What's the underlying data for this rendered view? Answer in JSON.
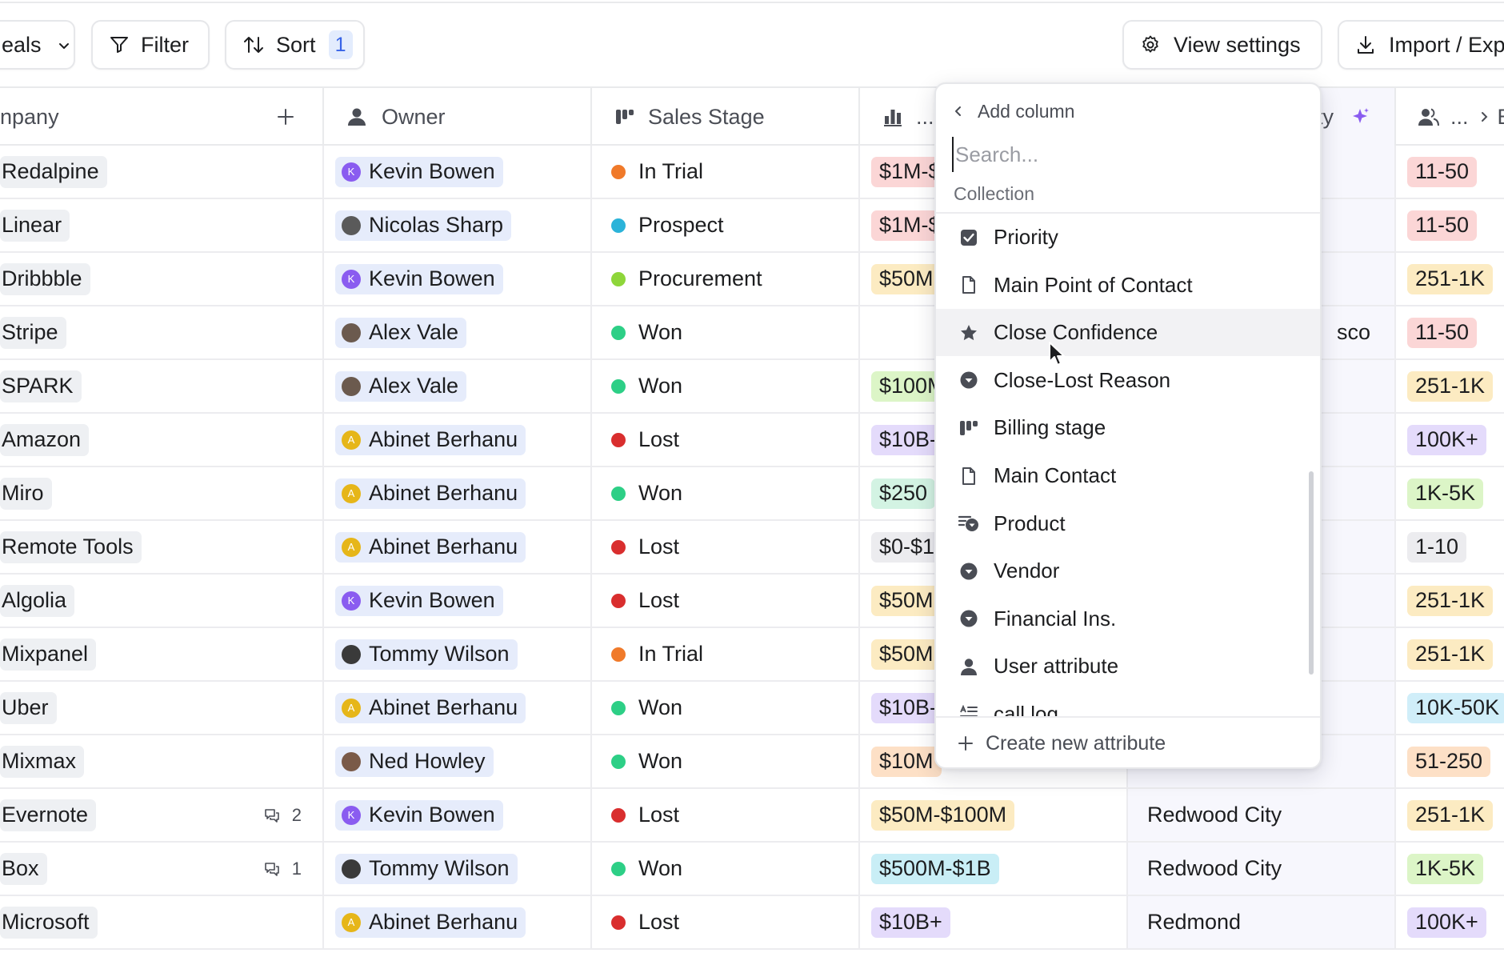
{
  "toolbar": {
    "view_selector_label": "eals",
    "filter_label": "Filter",
    "sort_label": "Sort",
    "sort_count": "1",
    "view_settings_label": "View settings",
    "import_export_label": "Import / Exp"
  },
  "columns": {
    "company": "npany",
    "owner": "Owner",
    "sales_stage": "Sales Stage",
    "col4": "...",
    "col5_suffix": "ty",
    "col6": "...",
    "col6_next": "E"
  },
  "rows": [
    {
      "company": "Redalpine",
      "owner": "Kevin Bowen",
      "owner_initial": "K",
      "avatar_color": "#8a5cf0",
      "stage": "In Trial",
      "stage_color": "#f07a2a",
      "revenue": "$1M-$",
      "revenue_color": "#fbd6d6",
      "location": "",
      "size": "11-50",
      "size_color": "#fbd6d6",
      "comments": ""
    },
    {
      "company": "Linear",
      "owner": "Nicolas Sharp",
      "owner_initial": "",
      "avatar_color": "#5a5a5a",
      "stage": "Prospect",
      "stage_color": "#2bb3d9",
      "revenue": "$1M-$",
      "revenue_color": "#fbd6d6",
      "location": "",
      "size": "11-50",
      "size_color": "#fbd6d6",
      "comments": ""
    },
    {
      "company": "Dribbble",
      "owner": "Kevin Bowen",
      "owner_initial": "K",
      "avatar_color": "#8a5cf0",
      "stage": "Procurement",
      "stage_color": "#8ed63a",
      "revenue": "$50M",
      "revenue_color": "#fcebc2",
      "location": "",
      "size": "251-1K",
      "size_color": "#fcebc2",
      "comments": ""
    },
    {
      "company": "Stripe",
      "owner": "Alex Vale",
      "owner_initial": "",
      "avatar_color": "#6b5a4e",
      "stage": "Won",
      "stage_color": "#2dcf86",
      "revenue": "",
      "revenue_color": "",
      "location": "sco",
      "size": "11-50",
      "size_color": "#fbd6d6",
      "comments": ""
    },
    {
      "company": "SPARK",
      "owner": "Alex Vale",
      "owner_initial": "",
      "avatar_color": "#6b5a4e",
      "stage": "Won",
      "stage_color": "#2dcf86",
      "revenue": "$100M",
      "revenue_color": "#dcf5c7",
      "location": "",
      "size": "251-1K",
      "size_color": "#fcebc2",
      "comments": ""
    },
    {
      "company": "Amazon",
      "owner": "Abinet Berhanu",
      "owner_initial": "A",
      "avatar_color": "#e6b619",
      "stage": "Lost",
      "stage_color": "#d92e2e",
      "revenue": "$10B-",
      "revenue_color": "#e4dbfb",
      "location": "",
      "size": "100K+",
      "size_color": "#e4dbfb",
      "comments": ""
    },
    {
      "company": "Miro",
      "owner": "Abinet Berhanu",
      "owner_initial": "A",
      "avatar_color": "#e6b619",
      "stage": "Won",
      "stage_color": "#2dcf86",
      "revenue": "$250",
      "revenue_color": "#d3f3e3",
      "location": "",
      "size": "1K-5K",
      "size_color": "#dcf5c7",
      "comments": ""
    },
    {
      "company": "Remote Tools",
      "owner": "Abinet Berhanu",
      "owner_initial": "A",
      "avatar_color": "#e6b619",
      "stage": "Lost",
      "stage_color": "#d92e2e",
      "revenue": "$0-$1",
      "revenue_color": "#ececef",
      "location": "",
      "size": "1-10",
      "size_color": "#ececef",
      "comments": ""
    },
    {
      "company": "Algolia",
      "owner": "Kevin Bowen",
      "owner_initial": "K",
      "avatar_color": "#8a5cf0",
      "stage": "Lost",
      "stage_color": "#d92e2e",
      "revenue": "$50M",
      "revenue_color": "#fcebc2",
      "location": "",
      "size": "251-1K",
      "size_color": "#fcebc2",
      "comments": ""
    },
    {
      "company": "Mixpanel",
      "owner": "Tommy Wilson",
      "owner_initial": "",
      "avatar_color": "#3a3a3a",
      "stage": "In Trial",
      "stage_color": "#f07a2a",
      "revenue": "$50M",
      "revenue_color": "#fcebc2",
      "location": "",
      "size": "251-1K",
      "size_color": "#fcebc2",
      "comments": ""
    },
    {
      "company": "Uber",
      "owner": "Abinet Berhanu",
      "owner_initial": "A",
      "avatar_color": "#e6b619",
      "stage": "Won",
      "stage_color": "#2dcf86",
      "revenue": "$10B-",
      "revenue_color": "#e4dbfb",
      "location": "",
      "size": "10K-50K",
      "size_color": "#d0eef9",
      "comments": ""
    },
    {
      "company": "Mixmax",
      "owner": "Ned Howley",
      "owner_initial": "",
      "avatar_color": "#7a5a48",
      "stage": "Won",
      "stage_color": "#2dcf86",
      "revenue": "$10M",
      "revenue_color": "#fde0c6",
      "location": "",
      "size": "51-250",
      "size_color": "#fde0c6",
      "comments": ""
    },
    {
      "company": "Evernote",
      "owner": "Kevin Bowen",
      "owner_initial": "K",
      "avatar_color": "#8a5cf0",
      "stage": "Lost",
      "stage_color": "#d92e2e",
      "revenue": "$50M-$100M",
      "revenue_color": "#fcebc2",
      "location": "Redwood City",
      "size": "251-1K",
      "size_color": "#fcebc2",
      "comments": "2"
    },
    {
      "company": "Box",
      "owner": "Tommy Wilson",
      "owner_initial": "",
      "avatar_color": "#3a3a3a",
      "stage": "Won",
      "stage_color": "#2dcf86",
      "revenue": "$500M-$1B",
      "revenue_color": "#c9eef6",
      "location": "Redwood City",
      "size": "1K-5K",
      "size_color": "#dcf5c7",
      "comments": "1"
    },
    {
      "company": "Microsoft",
      "owner": "Abinet Berhanu",
      "owner_initial": "A",
      "avatar_color": "#e6b619",
      "stage": "Lost",
      "stage_color": "#d92e2e",
      "revenue": "$10B+",
      "revenue_color": "#e4dbfb",
      "location": "Redmond",
      "size": "100K+",
      "size_color": "#e4dbfb",
      "comments": ""
    }
  ],
  "dropdown": {
    "back_label": "Add column",
    "search_placeholder": "Search...",
    "section_label": "Collection",
    "items": [
      {
        "label": "Priority",
        "icon": "checkbox-icon"
      },
      {
        "label": "Main Point of Contact",
        "icon": "document-icon"
      },
      {
        "label": "Close Confidence",
        "icon": "star-icon"
      },
      {
        "label": "Close-Lost Reason",
        "icon": "select-icon"
      },
      {
        "label": "Billing stage",
        "icon": "status-icon"
      },
      {
        "label": "Main Contact",
        "icon": "document-icon"
      },
      {
        "label": "Product",
        "icon": "multiselect-icon"
      },
      {
        "label": "Vendor",
        "icon": "select-icon"
      },
      {
        "label": "Financial Ins.",
        "icon": "select-icon"
      },
      {
        "label": "User attribute",
        "icon": "user-icon"
      },
      {
        "label": "call log",
        "icon": "text-icon"
      }
    ],
    "hover_item": "Close Confidence",
    "footer_label": "Create new attribute"
  }
}
